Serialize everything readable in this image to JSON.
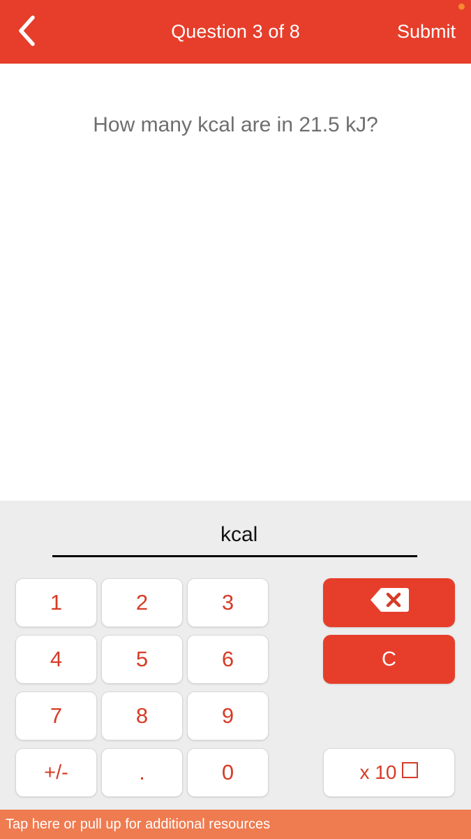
{
  "header": {
    "back_icon": "chevron-left-icon",
    "title": "Question 3 of 8",
    "submit_label": "Submit",
    "background_color": "#e63e2b",
    "text_color": "#ffffff",
    "corner_dot_color": "#f5892f"
  },
  "question": {
    "text": "How many kcal are in 21.5 kJ?",
    "text_color": "#6e6e6e"
  },
  "answer": {
    "value": "",
    "unit": "kcal",
    "placeholder": ""
  },
  "keypad": {
    "background_color": "#ededed",
    "number_key_color": "#d63b26",
    "action_key_color": "#e63e2b",
    "rows": [
      [
        {
          "label": "1",
          "name": "key-1",
          "type": "number"
        },
        {
          "label": "2",
          "name": "key-2",
          "type": "number"
        },
        {
          "label": "3",
          "name": "key-3",
          "type": "number"
        }
      ],
      [
        {
          "label": "4",
          "name": "key-4",
          "type": "number"
        },
        {
          "label": "5",
          "name": "key-5",
          "type": "number"
        },
        {
          "label": "6",
          "name": "key-6",
          "type": "number"
        }
      ],
      [
        {
          "label": "7",
          "name": "key-7",
          "type": "number"
        },
        {
          "label": "8",
          "name": "key-8",
          "type": "number"
        },
        {
          "label": "9",
          "name": "key-9",
          "type": "number"
        }
      ],
      [
        {
          "label": "+/-",
          "name": "key-sign",
          "type": "number"
        },
        {
          "label": ".",
          "name": "key-decimal",
          "type": "number"
        },
        {
          "label": "0",
          "name": "key-0",
          "type": "number"
        }
      ]
    ],
    "actions": {
      "backspace_icon": "backspace-delete-icon",
      "clear_label": "C",
      "exponent_label": "x 10"
    }
  },
  "footer": {
    "text": "Tap here or pull up for additional resources",
    "background_color": "#ef7b50",
    "text_color": "#ffffff"
  }
}
